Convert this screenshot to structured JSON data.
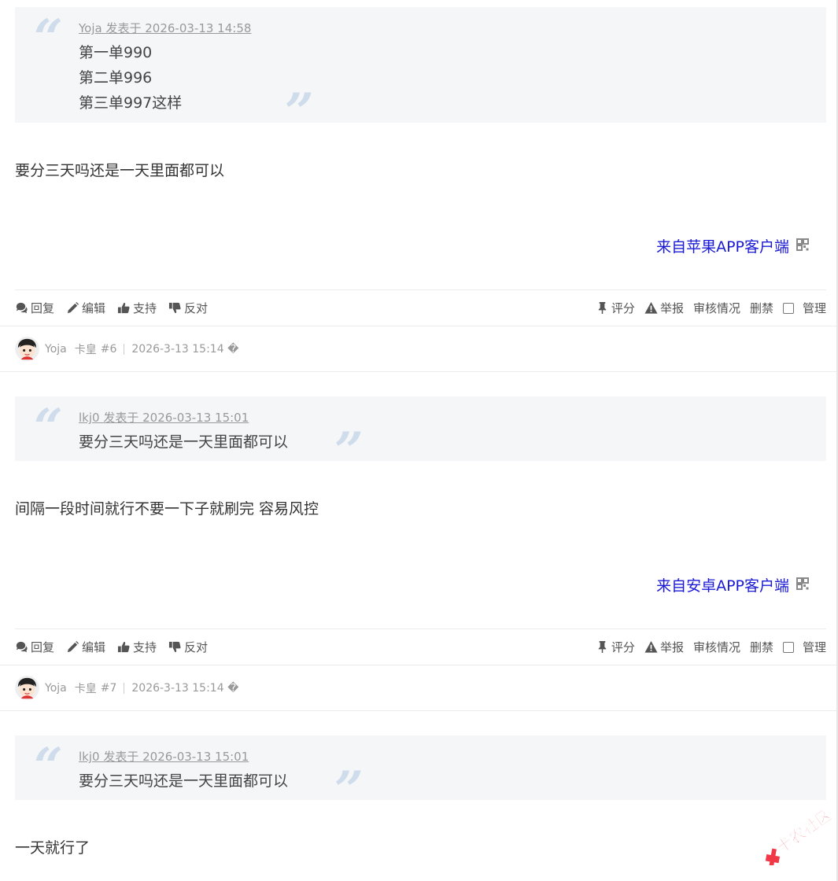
{
  "posts": [
    {
      "quote": {
        "meta": "Yoja 发表于 2026-03-13 14:58",
        "lines": [
          "第一单990",
          "第二单996",
          "第三单997这样"
        ]
      },
      "body": "要分三天吗还是一天里面都可以",
      "client": "来自苹果APP客户端"
    },
    {
      "author": {
        "name": "Yoja",
        "rank": "卡皇",
        "floor": "#6",
        "time": "2026-3-13 15:14 �"
      },
      "quote": {
        "meta": "lkj0 发表于 2026-03-13 15:01",
        "lines": [
          "要分三天吗还是一天里面都可以"
        ]
      },
      "body": "间隔一段时间就行不要一下子就刷完 容易风控",
      "client": "来自安卓APP客户端"
    },
    {
      "author": {
        "name": "Yoja",
        "rank": "卡皇",
        "floor": "#7",
        "time": "2026-3-13 15:14 �"
      },
      "quote": {
        "meta": "lkj0 发表于 2026-03-13 15:01",
        "lines": [
          "要分三天吗还是一天里面都可以"
        ]
      },
      "body": "一天就行了"
    }
  ],
  "actions": {
    "reply": "回复",
    "edit": "编辑",
    "support": "支持",
    "oppose": "反对",
    "rate": "评分",
    "report": "举报",
    "review": "审核情况",
    "ban": "删禁",
    "manage": "管理"
  },
  "watermark": "卡农社区",
  "colors": {
    "client_link": "#1a1ad6",
    "quote_bg": "#f5f6f8",
    "quote_mark": "#cfdceb"
  }
}
